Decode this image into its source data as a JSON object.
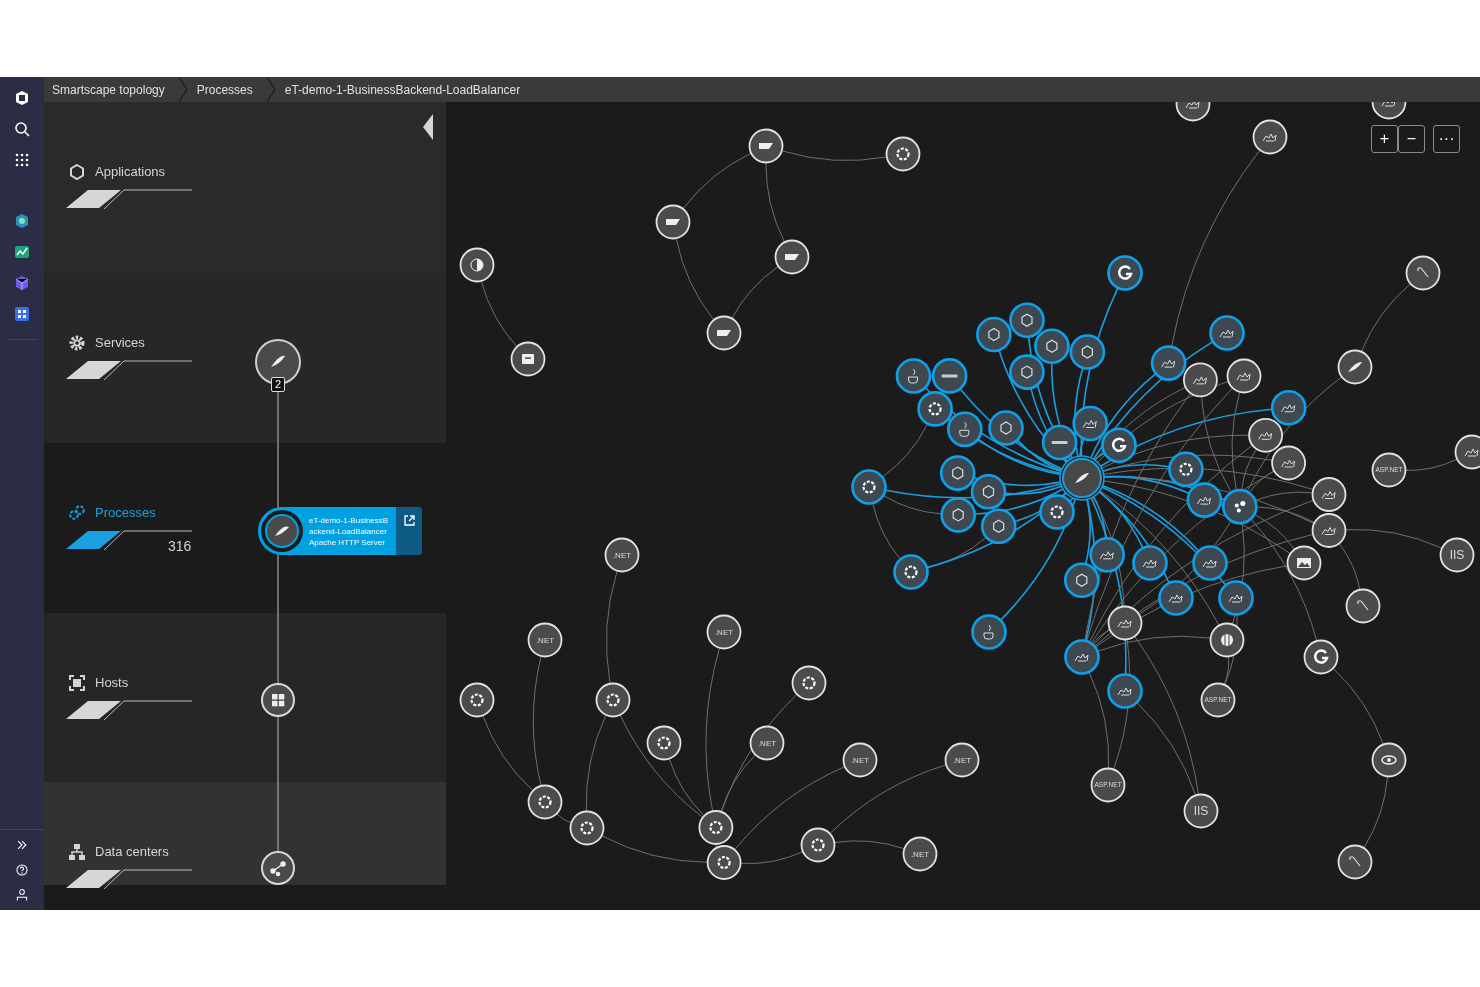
{
  "breadcrumb": [
    {
      "label": "Smartscape topology"
    },
    {
      "label": "Processes"
    },
    {
      "label": "eT-demo-1-BusinessBackend-LoadBalancer"
    }
  ],
  "layers": [
    {
      "label": "Applications",
      "selected": false
    },
    {
      "label": "Services",
      "selected": false
    },
    {
      "label": "Processes",
      "selected": true,
      "count": "316"
    },
    {
      "label": "Hosts",
      "selected": false
    },
    {
      "label": "Data centers",
      "selected": false
    }
  ],
  "timeline": {
    "services_badge": "2",
    "selected_process": {
      "name": "eT-demo-1-BusinessBackend-LoadBalancer",
      "type": "Apache HTTP Server"
    }
  },
  "zoom_controls": [
    "+",
    "−",
    "···"
  ],
  "graph": {
    "nodes": [
      {
        "kind": "icon",
        "highlighted": false
      },
      {
        "kind": "icon",
        "highlighted": false
      },
      {
        "kind": "icon",
        "highlighted": false
      },
      {
        "kind": "icon",
        "highlighted": false
      },
      {
        "kind": "icon",
        "highlighted": false
      },
      {
        "kind": "icon",
        "highlighted": false
      },
      {
        "kind": "icon",
        "highlighted": false
      },
      {
        "kind": "icon",
        "highlighted": false
      },
      {
        "kind": "icon",
        "highlighted": false
      },
      {
        "kind": "icon",
        "highlighted": false
      },
      {
        "kind": "icon",
        "highlighted": true
      },
      {
        "kind": "icon",
        "highlighted": true
      },
      {
        "kind": "icon",
        "highlighted": true
      },
      {
        "kind": "icon",
        "highlighted": true
      },
      {
        "kind": "icon",
        "highlighted": true
      },
      {
        "kind": "icon",
        "highlighted": true
      },
      {
        "kind": "icon",
        "highlighted": true
      },
      {
        "kind": "icon",
        "highlighted": true
      },
      {
        "kind": "icon",
        "highlighted": true
      },
      {
        "kind": "icon",
        "highlighted": true
      },
      {
        "kind": "icon",
        "highlighted": true
      },
      {
        "kind": "icon",
        "highlighted": true
      },
      {
        "kind": "icon",
        "highlighted": true
      },
      {
        "kind": "icon",
        "highlighted": true
      },
      {
        "kind": "icon",
        "highlighted": true
      },
      {
        "kind": "icon",
        "highlighted": true
      },
      {
        "kind": "icon",
        "highlighted": true
      },
      {
        "kind": "icon",
        "highlighted": true
      },
      {
        "kind": "icon",
        "highlighted": true
      },
      {
        "kind": "icon",
        "highlighted": true
      },
      {
        "kind": "icon",
        "highlighted": true
      },
      {
        "kind": "icon",
        "highlighted": true
      },
      {
        "kind": "icon",
        "highlighted": true
      },
      {
        "kind": "icon",
        "highlighted": true
      },
      {
        "kind": "icon",
        "highlighted": true
      },
      {
        "kind": "icon",
        "highlighted": true
      },
      {
        "kind": "icon",
        "highlighted": true
      },
      {
        "kind": "icon",
        "highlighted": true
      },
      {
        "kind": "icon",
        "highlighted": true
      },
      {
        "kind": "icon",
        "highlighted": true
      },
      {
        "kind": "icon",
        "highlighted": true
      },
      {
        "kind": "icon",
        "highlighted": true
      },
      {
        "kind": "icon",
        "highlighted": true
      },
      {
        "kind": "icon",
        "highlighted": true
      },
      {
        "kind": "icon",
        "highlighted": true
      },
      {
        "kind": "icon",
        "highlighted": true
      },
      {
        "kind": "icon",
        "highlighted": false
      },
      {
        "kind": "icon",
        "highlighted": false
      },
      {
        "kind": "icon",
        "highlighted": false
      },
      {
        "kind": "icon",
        "highlighted": false
      },
      {
        "kind": "icon",
        "highlighted": false
      },
      {
        "kind": "icon",
        "highlighted": false
      },
      {
        "kind": "icon",
        "highlighted": false
      },
      {
        "kind": "icon",
        "highlighted": false
      },
      {
        "kind": "icon",
        "highlighted": false
      },
      {
        "kind": "label",
        "label": "ASP.NET",
        "highlighted": false
      },
      {
        "kind": "label",
        "label": "IIS",
        "highlighted": false
      },
      {
        "kind": "icon",
        "highlighted": false
      },
      {
        "kind": "icon",
        "highlighted": false
      },
      {
        "kind": "icon",
        "highlighted": false
      },
      {
        "kind": "icon",
        "highlighted": false
      },
      {
        "kind": "icon",
        "highlighted": false
      },
      {
        "kind": "label",
        "label": "ASP.NET",
        "highlighted": false
      },
      {
        "kind": "label",
        "label": "ASP.NET",
        "highlighted": false
      },
      {
        "kind": "label",
        "label": "IIS",
        "highlighted": false
      },
      {
        "kind": "icon",
        "highlighted": false
      },
      {
        "kind": "icon",
        "highlighted": false
      },
      {
        "kind": "label",
        "label": ".NET",
        "highlighted": false
      },
      {
        "kind": "label",
        "label": ".NET",
        "highlighted": false
      },
      {
        "kind": "label",
        "label": ".NET",
        "highlighted": false
      },
      {
        "kind": "icon",
        "highlighted": false
      },
      {
        "kind": "icon",
        "highlighted": false
      },
      {
        "kind": "icon",
        "highlighted": false
      },
      {
        "kind": "icon",
        "highlighted": false
      },
      {
        "kind": "label",
        "label": ".NET",
        "highlighted": false
      },
      {
        "kind": "label",
        "label": ".NET",
        "highlighted": false
      },
      {
        "kind": "label",
        "label": ".NET",
        "highlighted": false
      },
      {
        "kind": "icon",
        "highlighted": false
      },
      {
        "kind": "icon",
        "highlighted": false
      },
      {
        "kind": "icon",
        "highlighted": false
      },
      {
        "kind": "icon",
        "highlighted": false
      },
      {
        "kind": "icon",
        "highlighted": false
      },
      {
        "kind": "label",
        "label": ".NET",
        "highlighted": false
      },
      {
        "kind": "icon",
        "highlighted": true
      }
    ]
  }
}
